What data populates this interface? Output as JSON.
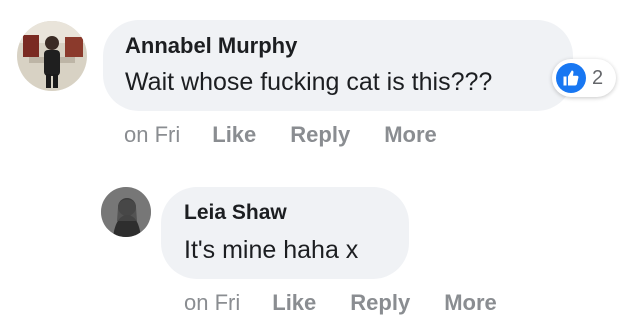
{
  "comments": [
    {
      "author": "Annabel Murphy",
      "text": "Wait whose fucking cat is this???",
      "reactions": {
        "icon": "like-icon",
        "count": "2"
      },
      "timestamp": "on Fri",
      "actions": {
        "like": "Like",
        "reply": "Reply",
        "more": "More"
      }
    },
    {
      "author": "Leia Shaw",
      "text": "It's mine haha x",
      "timestamp": "on Fri",
      "actions": {
        "like": "Like",
        "reply": "Reply",
        "more": "More"
      }
    }
  ],
  "colors": {
    "bubble": "#f0f2f5",
    "like_blue": "#1877f2",
    "meta_gray": "#8a8d91"
  }
}
